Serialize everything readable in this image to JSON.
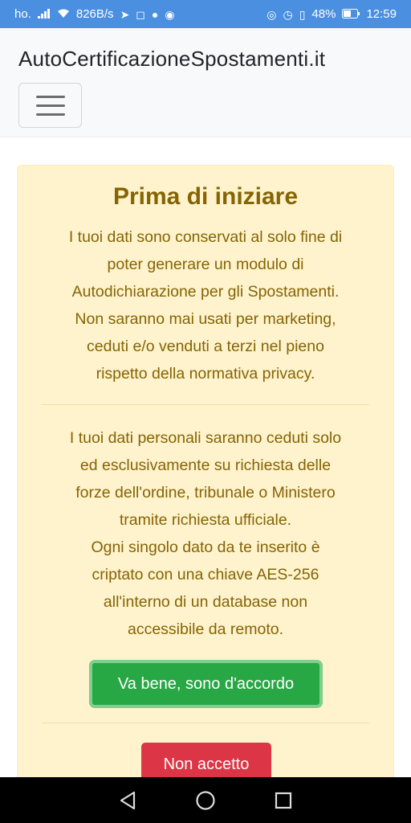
{
  "status_bar": {
    "carrier": "ho.",
    "network_speed": "826B/s",
    "battery": "48%",
    "time": "12:59"
  },
  "header": {
    "brand": "AutoCertificazioneSpostamenti.it",
    "menu_icon": "hamburger-icon"
  },
  "notice": {
    "title": "Prima di iniziare",
    "paragraph1": [
      "I tuoi dati sono conservati al solo fine di",
      "poter generare un modulo di",
      "Autodichiarazione per gli Spostamenti.",
      "Non saranno mai usati per marketing,",
      "ceduti e/o venduti a terzi nel pieno",
      "rispetto della normativa privacy."
    ],
    "paragraph2": [
      "I tuoi dati personali saranno ceduti solo",
      "ed esclusivamente su richiesta delle",
      "forze dell'ordine, tribunale o Ministero",
      "tramite richiesta ufficiale.",
      "Ogni singolo dato da te inserito è",
      "criptato con una chiave AES-256",
      "all'interno di un database non",
      "accessibile da remoto."
    ],
    "accept_label": "Va bene, sono d'accordo",
    "decline_label": "Non accetto"
  },
  "colors": {
    "status_bar": "#4a8fe0",
    "alert_bg": "#fff3cd",
    "alert_text": "#856404",
    "accept": "#28a745",
    "decline": "#dc3545"
  }
}
